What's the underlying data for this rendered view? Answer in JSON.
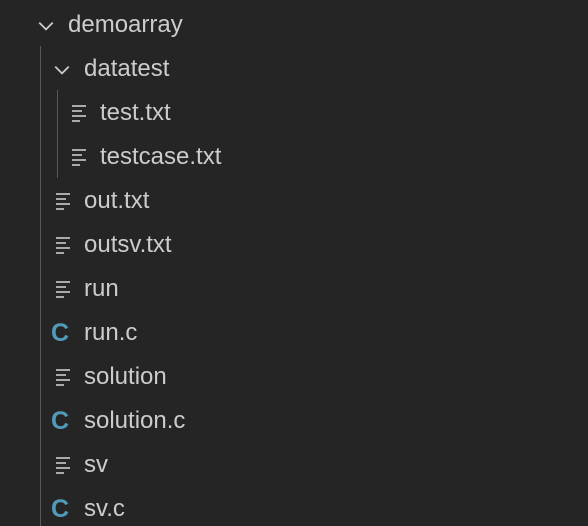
{
  "explorer": {
    "root": {
      "label": "demoarray",
      "icon": "chevron-down-icon",
      "expanded": true
    },
    "folder": {
      "label": "datatest",
      "icon": "chevron-down-icon",
      "expanded": true,
      "children": [
        {
          "label": "test.txt",
          "icon": "text-file-icon"
        },
        {
          "label": "testcase.txt",
          "icon": "text-file-icon"
        }
      ]
    },
    "files": [
      {
        "label": "out.txt",
        "icon": "text-file-icon"
      },
      {
        "label": "outsv.txt",
        "icon": "text-file-icon"
      },
      {
        "label": "run",
        "icon": "text-file-icon"
      },
      {
        "label": "run.c",
        "icon": "c-file-icon"
      },
      {
        "label": "solution",
        "icon": "text-file-icon"
      },
      {
        "label": "solution.c",
        "icon": "c-file-icon"
      },
      {
        "label": "sv",
        "icon": "text-file-icon"
      },
      {
        "label": "sv.c",
        "icon": "c-file-icon"
      }
    ],
    "c_icon_glyph": "C",
    "colors": {
      "background": "#252526",
      "text": "#cccccc",
      "c_icon": "#519aba",
      "indent_guide": "#585858"
    }
  }
}
